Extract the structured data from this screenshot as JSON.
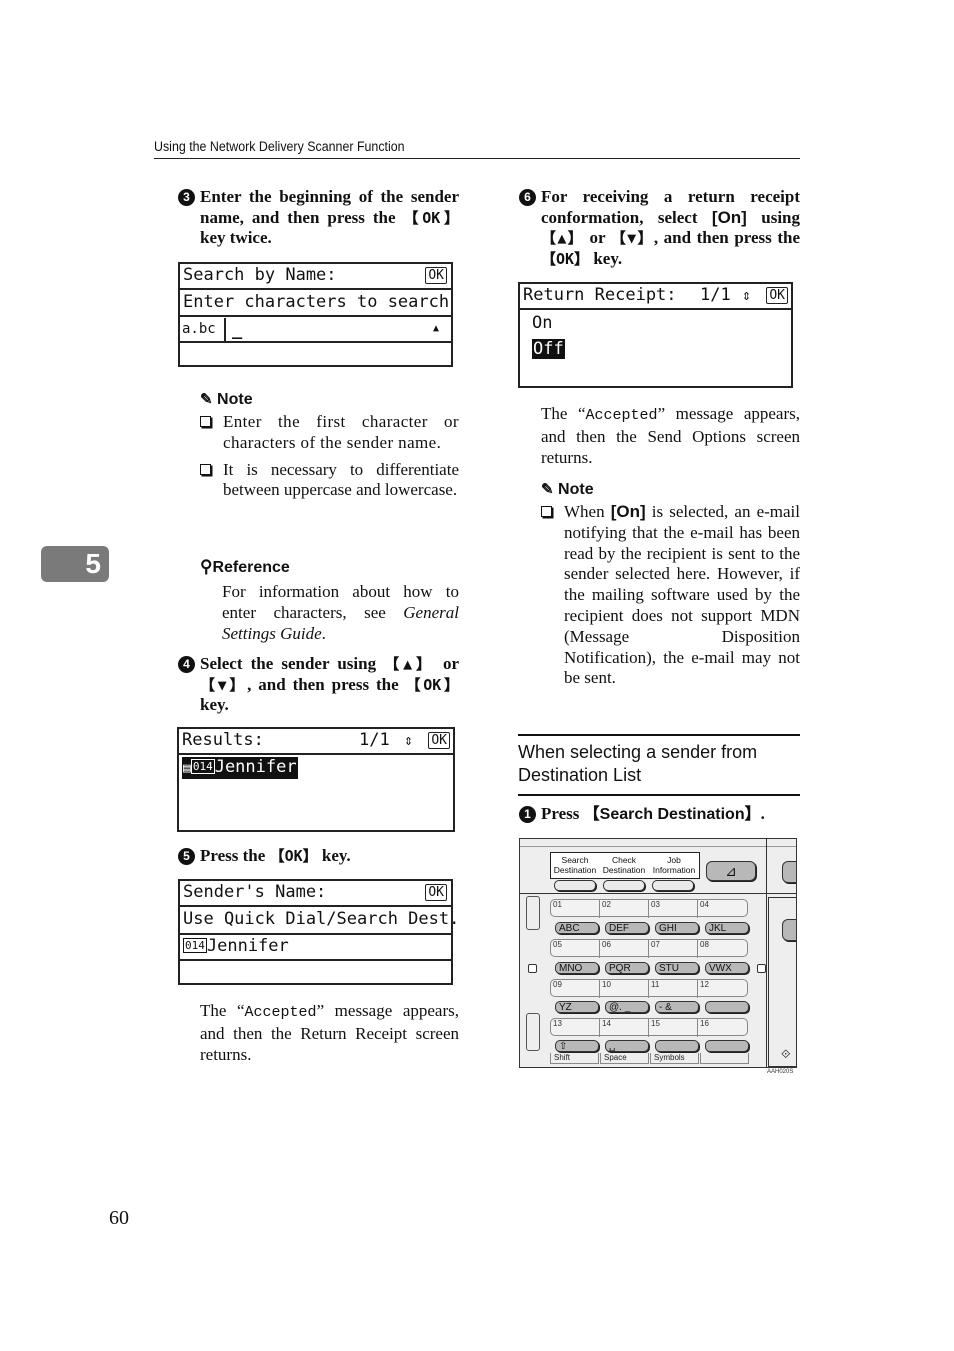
{
  "header": {
    "title": "Using the Network Delivery Scanner Function"
  },
  "chapter_tab": "5",
  "page_number": "60",
  "left_column": {
    "step3": {
      "number": "3",
      "text_before": "Enter the beginning of the sender name, and then press the ",
      "key": "【OK】",
      "text_after": " key twice."
    },
    "lcd_search": {
      "title": "Search by Name:",
      "ok": "OK",
      "prompt": "Enter characters to search",
      "mode": "a.bc",
      "cursor": "_",
      "arrow": "▲",
      "input_value": ""
    },
    "note1": {
      "heading": "Note",
      "items": [
        "Enter the first character or characters of the sender name.",
        "It is necessary to differentiate between uppercase and lowercase."
      ]
    },
    "reference": {
      "heading": "Reference",
      "text_before": "For information about how to enter characters, see ",
      "italic": "General Settings Guide",
      "text_after": "."
    },
    "step4": {
      "number": "4",
      "text_a": "Select the sender using ",
      "key_up": "【▲】",
      "text_b": " or ",
      "key_down": "【▼】",
      "text_c": ", and then press the ",
      "key_ok": "【OK】",
      "text_d": " key."
    },
    "lcd_results": {
      "title": "Results:",
      "page": "1/1",
      "updown": "⇕",
      "ok": "OK",
      "entry_code": "014",
      "entry_name": "Jennifer"
    },
    "step5": {
      "number": "5",
      "text_before": "Press the ",
      "key": "【OK】",
      "text_after": " key."
    },
    "lcd_sender": {
      "title": "Sender's Name:",
      "ok": "OK",
      "line2": "Use Quick Dial/Search Dest.",
      "entry_code": "014",
      "entry_name": "Jennifer"
    },
    "after_text": {
      "before": "The “",
      "mono": "Accepted",
      "after": "” message appears, and then the Return Receipt screen returns."
    }
  },
  "right_column": {
    "step6": {
      "number": "6",
      "text_a": "For receiving a return receipt conformation, select ",
      "option": "[On]",
      "text_b": " using ",
      "key_up": "【▲】",
      "text_c": " or ",
      "key_down": "【▼】",
      "text_d": ", and then press the ",
      "key_ok": "【OK】",
      "text_e": " key."
    },
    "lcd_return": {
      "title": "Return Receipt:",
      "page": "1/1",
      "updown": "⇕",
      "ok": "OK",
      "options": [
        "On",
        "Off"
      ],
      "selected": "Off"
    },
    "after_text": {
      "before": "The “",
      "mono": "Accepted",
      "after": "” message appears, and then the Send Options screen returns."
    },
    "note2": {
      "heading": "Note",
      "text_before": "When ",
      "option": "[On]",
      "text_after": " is selected, an e-mail notifying that the e-mail has been read by the recipient is sent to the sender selected here. However, if the mailing software used by the recipient does not support MDN (Message Disposition Notification), the e-mail may not be sent."
    },
    "section_title": "When selecting a sender from Destination List",
    "step1": {
      "number": "1",
      "text_before": "Press ",
      "key": "【Search Destination】",
      "text_after": "."
    },
    "panel": {
      "tabs": [
        "Search Destination",
        "Check Destination",
        "Job Information"
      ],
      "quick_rows": [
        [
          "01",
          "02",
          "03",
          "04"
        ],
        [
          "05",
          "06",
          "07",
          "08"
        ],
        [
          "09",
          "10",
          "11",
          "12"
        ],
        [
          "13",
          "14",
          "15",
          "16"
        ]
      ],
      "letter_rows": [
        [
          "ABC",
          "DEF",
          "GHI",
          "JKL"
        ],
        [
          "MNO",
          "PQR",
          "STU",
          "VWX"
        ],
        [
          "YZ",
          "@. _",
          "- &",
          ""
        ]
      ],
      "bottom_labels": [
        "Shift",
        "Space",
        "Symbols",
        ""
      ],
      "image_code": "AAH020S"
    }
  }
}
